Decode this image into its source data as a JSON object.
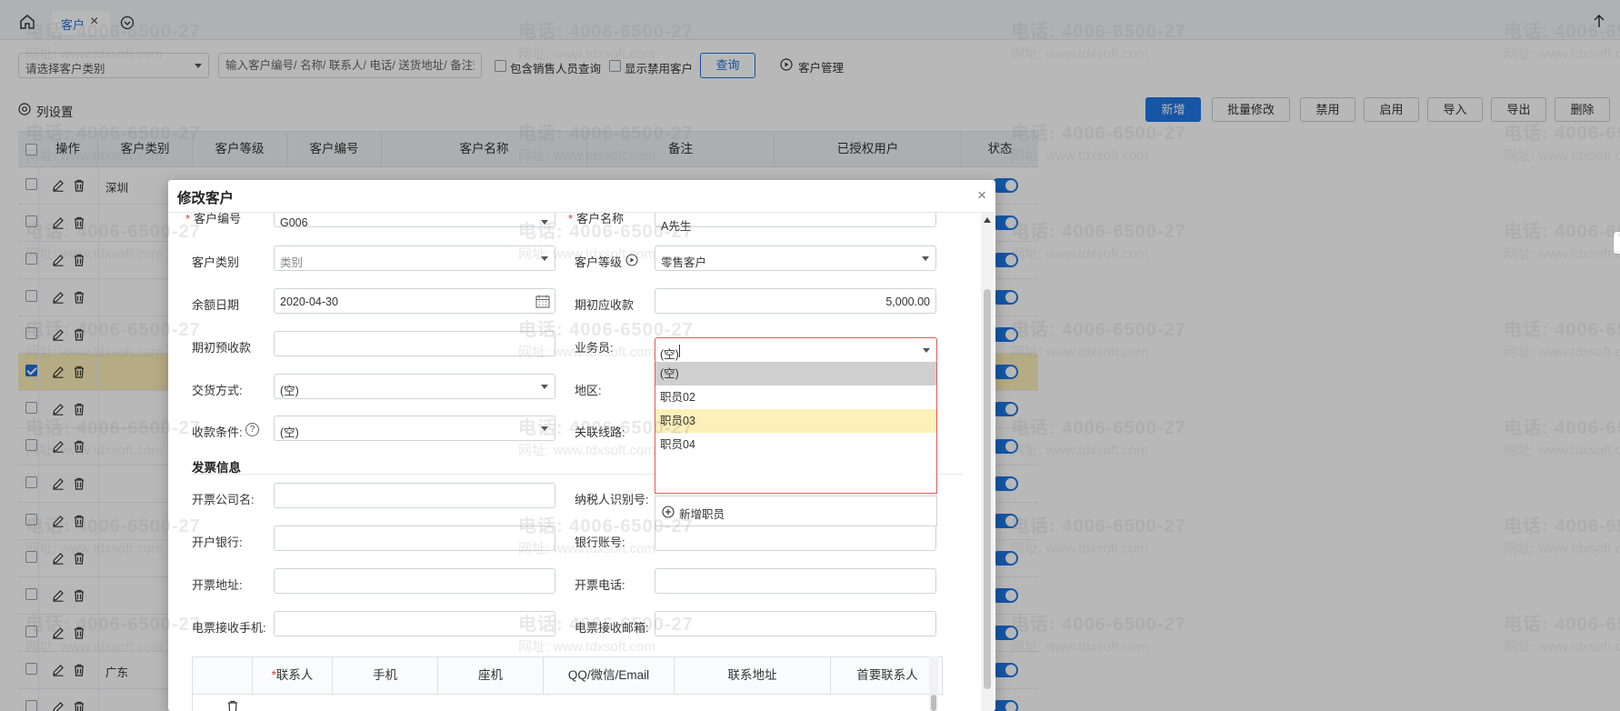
{
  "tabbar": {
    "tab_label": "客户"
  },
  "filter": {
    "category_placeholder": "请选择客户类别",
    "search_placeholder": "输入客户编号/ 名称/ 联系人/ 电话/ 送货地址/ 备注查询",
    "include_sales_label": "包含销售人员查询",
    "show_disabled_label": "显示禁用客户",
    "query_label": "查询",
    "customer_mgmt_label": "客户管理"
  },
  "toolbar": {
    "column_settings_label": "列设置",
    "add_label": "新增",
    "batch_edit_label": "批量修改",
    "disable_label": "禁用",
    "enable_label": "启用",
    "import_label": "导入",
    "export_label": "导出",
    "delete_label": "删除"
  },
  "table": {
    "headers": [
      "操作",
      "客户类别",
      "客户等级",
      "客户编号",
      "客户名称",
      "备注",
      "已授权用户",
      "状态"
    ],
    "rows": [
      {
        "category": "深圳",
        "checked": false
      },
      {
        "category": "",
        "checked": false
      },
      {
        "category": "",
        "checked": false
      },
      {
        "category": "",
        "checked": false
      },
      {
        "category": "",
        "checked": false
      },
      {
        "category": "",
        "checked": true
      },
      {
        "category": "",
        "checked": false
      },
      {
        "category": "",
        "checked": false
      },
      {
        "category": "",
        "checked": false
      },
      {
        "category": "",
        "checked": false
      },
      {
        "category": "",
        "checked": false
      },
      {
        "category": "",
        "checked": false
      },
      {
        "category": "",
        "checked": false
      },
      {
        "category": "广东",
        "checked": false
      },
      {
        "category": "",
        "checked": false
      }
    ]
  },
  "modal": {
    "title": "修改客户",
    "fields": {
      "customer_no_label": "客户编号",
      "customer_no_value": "G006",
      "customer_name_label": "客户名称",
      "customer_name_value": "A先生",
      "category_label": "客户类别",
      "category_value": "类别",
      "level_label": "客户等级",
      "level_value": "零售客户",
      "balance_date_label": "余额日期",
      "balance_date_value": "2020-04-30",
      "initial_receivable_label": "期初应收款",
      "initial_receivable_value": "5,000.00",
      "initial_prepaid_label": "期初预收款",
      "salesperson_label": "业务员:",
      "salesperson_value": "(空)",
      "delivery_label": "交货方式:",
      "delivery_value": "(空)",
      "region_label": "地区:",
      "payment_label": "收款条件:",
      "payment_value": "(空)",
      "route_label": "关联线路:"
    },
    "invoice": {
      "section_title": "发票信息",
      "company_label": "开票公司名:",
      "taxpayer_label": "纳税人识别号:",
      "bank_label": "开户银行:",
      "account_label": "银行账号:",
      "address_label": "开票地址:",
      "phone_label": "开票电话:",
      "e_phone_label": "电票接收手机:",
      "e_email_label": "电票接收邮箱:"
    },
    "contacts_headers": [
      "*联系人",
      "手机",
      "座机",
      "QQ/微信/Email",
      "联系地址",
      "首要联系人"
    ],
    "dropdown": {
      "items": [
        "(空)",
        "职员02",
        "职员03",
        "职员04"
      ],
      "selected_index": 0,
      "hover_index": 2,
      "add_label": "新增职员"
    }
  },
  "watermark": {
    "phone": "电话: 4006-6500-27",
    "site": "网址: www.tdxsoft.com"
  },
  "colors": {
    "primary": "#1e78e6",
    "selected_row": "#fbeeb8",
    "required": "#e23b3b",
    "dropdown_border": "#e15a5a"
  }
}
